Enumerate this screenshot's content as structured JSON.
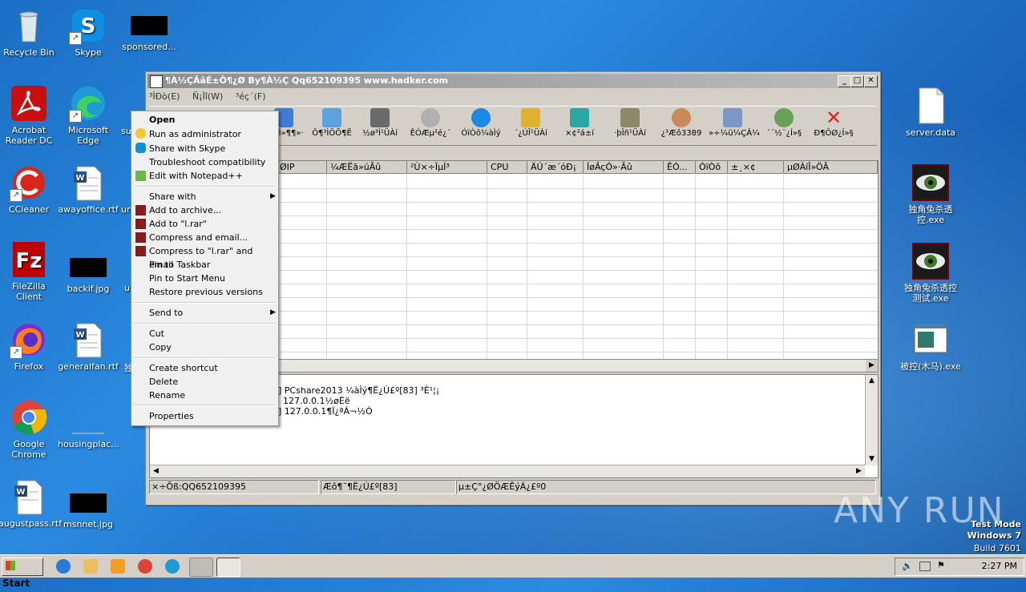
{
  "desktop": {
    "icons": [
      {
        "label": "Recycle Bin"
      },
      {
        "label": "Skype"
      },
      {
        "label": "sponsored..."
      },
      {
        "label": "Acrobat Reader DC"
      },
      {
        "label": "Microsoft Edge"
      },
      {
        "label": "CCleaner"
      },
      {
        "label": "awayoffice.rtf"
      },
      {
        "label": "FileZilla Client"
      },
      {
        "label": "backif.jpg"
      },
      {
        "label": "Firefox"
      },
      {
        "label": "generalfan.rtf"
      },
      {
        "label": "Google Chrome"
      },
      {
        "label": "housingplac..."
      },
      {
        "label": "augustpass.rtf"
      },
      {
        "label": "msnnet.jpg"
      },
      {
        "label": "server.data"
      },
      {
        "label": "独角兔杀透控.exe"
      },
      {
        "label": "独角兔杀透控测试.exe"
      },
      {
        "label": "被控(木马).exe"
      }
    ],
    "partial_labels": {
      "su": "su",
      "un": "un",
      "u": "u",
      "du": "独"
    }
  },
  "window": {
    "title": "¶À½ÇÃâÉ±Ô¶¿Ø By¶À½Ç Qq652109395 www.hadker.com",
    "menu": [
      "³ÌÐò(E)",
      "Ñ¡Ïî(W)",
      "³éç´(F)"
    ],
    "toolbar": [
      "Ô¶³Ì»¶¶»·",
      "Ô¶³ÌÖÕ¶Ë",
      "½ø³Ì¹ÜÀí",
      "ÊÓÆµ²é¿´",
      "ÓïÒô¼àÌý",
      "´¿ÚÎ¹ÜÀí",
      "×¢²á±í",
      "·þÎñ¹ÜÀí",
      "¿³Æô3389",
      "»÷¼ü¼ÇÂ¼",
      "´´½¨¿Í»§",
      "Ð¶ÔØ¿Í»§"
    ],
    "columns": [
      "ØIP",
      "¼ÆËã»úÃû",
      "²Ù×÷ÏµÍ³",
      "CPU",
      "ÄÚ´æ´óÐ¡",
      "ÍøÂçÓ»·Ãû",
      "ÊÓ...",
      "ÓïÒô",
      "±¸×¢",
      "µØÀíÎ»ÖÃ"
    ],
    "log": [
      "PCshare2013 ¼àÌý¶Ë¿Ú£º[83] ³É¹¦¡",
      "127.0.0.1½øÈë",
      "127.0.0.1¶Ï¿ªÁ¬½Ó"
    ],
    "log_prefix": "]",
    "status": [
      "×÷Õß:QQ652109395",
      "Æô¶¯¶Ë¿Ú£º[83]",
      "µ±Ç°¿ØÖÆÊýÁ¿£º0"
    ]
  },
  "context_menu": {
    "items": [
      {
        "label": "Open",
        "bold": true
      },
      {
        "label": "Run as administrator"
      },
      {
        "label": "Share with Skype"
      },
      {
        "label": "Troubleshoot compatibility"
      },
      {
        "label": "Edit with Notepad++"
      },
      {
        "label": "Share with"
      },
      {
        "label": "Add to archive..."
      },
      {
        "label": "Add to \"l.rar\""
      },
      {
        "label": "Compress and email..."
      },
      {
        "label": "Compress to \"l.rar\" and email"
      },
      {
        "label": "Pin to Taskbar"
      },
      {
        "label": "Pin to Start Menu"
      },
      {
        "label": "Restore previous versions"
      },
      {
        "label": "Send to"
      },
      {
        "label": "Cut"
      },
      {
        "label": "Copy"
      },
      {
        "label": "Create shortcut"
      },
      {
        "label": "Delete"
      },
      {
        "label": "Rename"
      },
      {
        "label": "Properties"
      }
    ]
  },
  "taskbar": {
    "start": "Start",
    "clock": "2:27 PM"
  },
  "watermark": "ANY RUN",
  "testmode": [
    "Test Mode",
    "Windows 7",
    "Build 7601"
  ]
}
